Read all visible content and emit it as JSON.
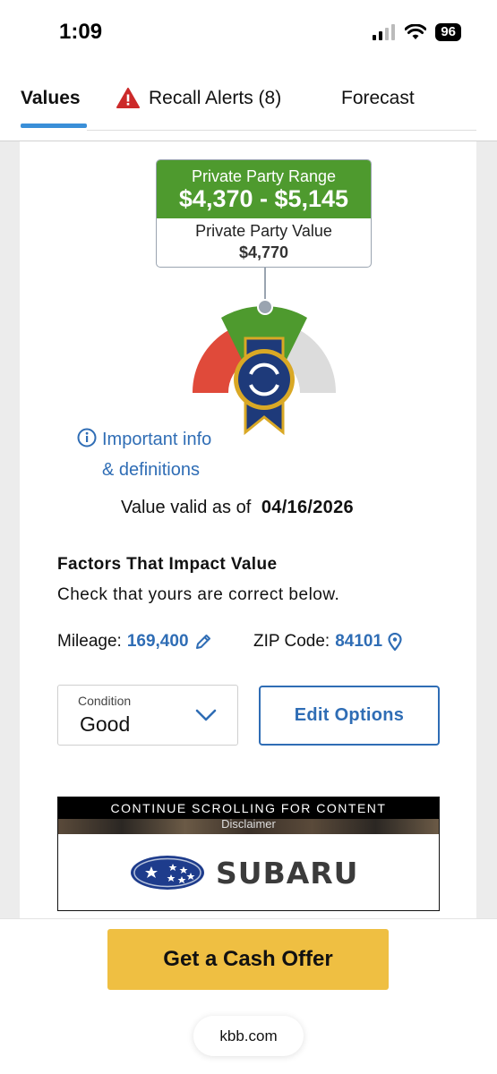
{
  "status_bar": {
    "time": "1:09",
    "battery": "96"
  },
  "tabs": [
    {
      "label": "Values",
      "active": true
    },
    {
      "label": "Recall Alerts (8)",
      "icon": "warning-icon"
    },
    {
      "label": "Forecast"
    }
  ],
  "valuation": {
    "range_label": "Private Party Range",
    "range_value": "$4,370 - $5,145",
    "value_label": "Private Party Value",
    "value": "$4,770"
  },
  "info_link": {
    "line1": "Important info",
    "line2": "& definitions"
  },
  "valid_as_of": {
    "label": "Value valid as of",
    "date": "04/16/2026"
  },
  "factors": {
    "title": "Factors That Impact Value",
    "subtitle": "Check that yours are correct below.",
    "mileage_label": "Mileage:",
    "mileage_value": "169,400",
    "zip_label": "ZIP Code:",
    "zip_value": "84101"
  },
  "condition": {
    "label": "Condition",
    "value": "Good"
  },
  "edit_options_label": "Edit Options",
  "ad": {
    "banner": "CONTINUE SCROLLING FOR CONTENT",
    "strip_text": "Disclaimer",
    "brand": "SUBARU"
  },
  "cta": {
    "label": "Get a Cash Offer"
  },
  "url": "kbb.com",
  "colors": {
    "green": "#4e9a2e",
    "link_blue": "#2f6db5",
    "tab_underline": "#3a8fd8",
    "cta_yellow": "#efbf42",
    "gauge_red": "#e04a3a",
    "gauge_gray": "#dcdcdc"
  }
}
